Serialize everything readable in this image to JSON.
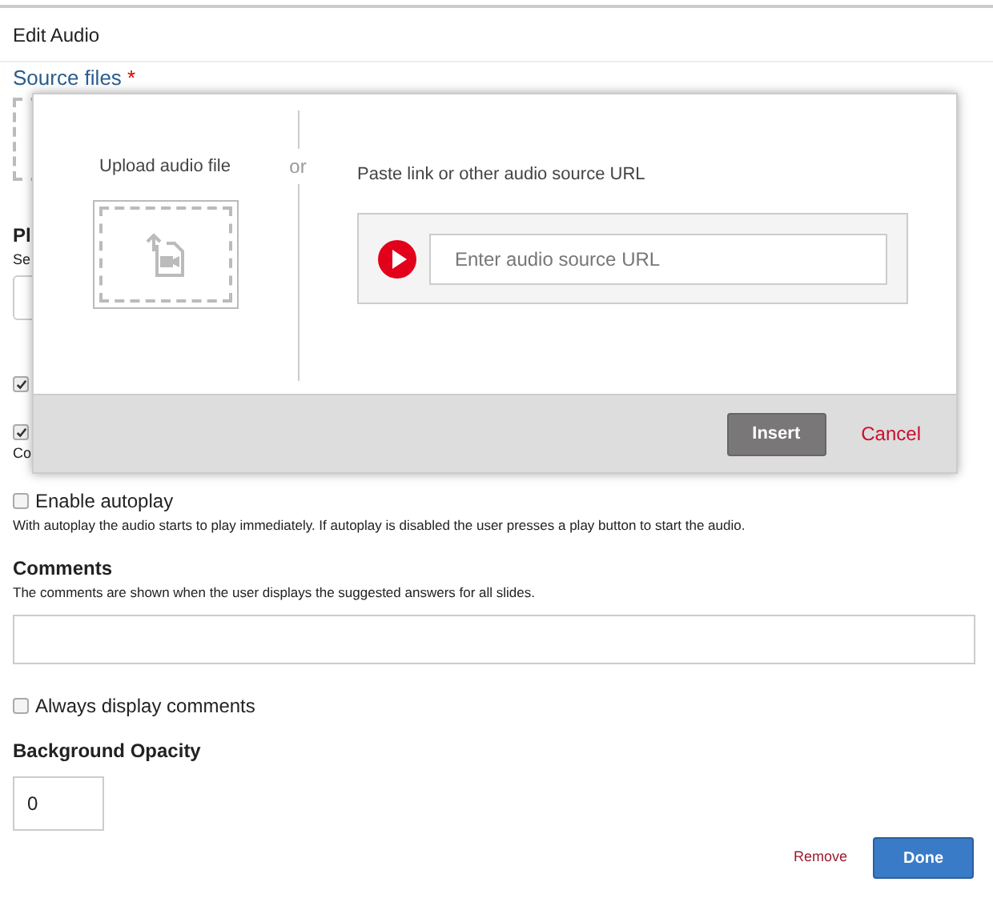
{
  "window": {
    "title": "Edit Audio"
  },
  "source_files": {
    "label": "Source files",
    "required_mark": "*"
  },
  "hidden_fields": {
    "heading": "Pl",
    "description": "Se",
    "checkboxes": [
      {
        "checked": true
      },
      {
        "checked": true
      }
    ],
    "note": "Co"
  },
  "autoplay": {
    "label": "Enable autoplay",
    "checked": false,
    "description": "With autoplay the audio starts to play immediately. If autoplay is disabled the user presses a play button to start the audio."
  },
  "comments": {
    "label": "Comments",
    "description": "The comments are shown when the user displays the suggested answers for all slides."
  },
  "always_display": {
    "label": "Always display comments",
    "checked": false
  },
  "opacity": {
    "label": "Background Opacity",
    "value": "0"
  },
  "footer": {
    "remove": "Remove",
    "done": "Done"
  },
  "popup": {
    "upload_label": "Upload audio file",
    "or": "or",
    "url_label": "Paste link or other audio source URL",
    "url_placeholder": "Enter audio source URL",
    "insert": "Insert",
    "cancel": "Cancel"
  }
}
